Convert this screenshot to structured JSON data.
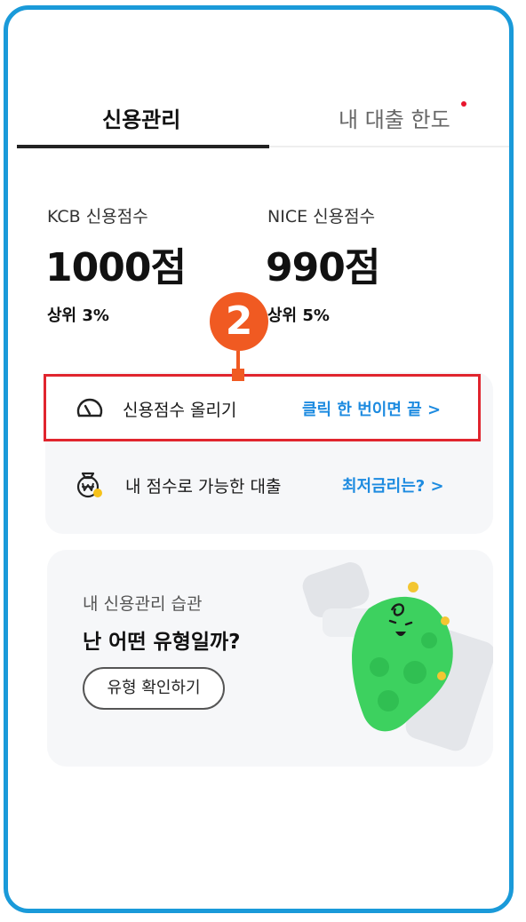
{
  "tabs": [
    {
      "label": "신용관리",
      "active": true
    },
    {
      "label": "내 대출 한도",
      "active": false,
      "has_dot": true
    }
  ],
  "scores": [
    {
      "label": "KCB 신용점수",
      "value": "1000점",
      "rank": "상위 3%"
    },
    {
      "label": "NICE 신용점수",
      "value": "990점",
      "rank": "상위 5%"
    }
  ],
  "annotation": {
    "number": "2",
    "color": "#f05a22",
    "highlight_color": "#e0252e"
  },
  "menu": [
    {
      "icon": "speedometer-icon",
      "title": "신용점수 올리기",
      "action": "클릭 한 번이면 끝 >"
    },
    {
      "icon": "money-bag-icon",
      "title": "내 점수로 가능한 대출",
      "action": "최저금리는? >"
    }
  ],
  "promo": {
    "subtitle": "내 신용관리 습관",
    "title": "난 어떤 유형일까?",
    "button": "유형 확인하기",
    "illustration": "green-cactus-character"
  },
  "colors": {
    "frame": "#1a9ad9",
    "accent_blue": "#1d8be0",
    "tab_dot": "#e8152d"
  }
}
